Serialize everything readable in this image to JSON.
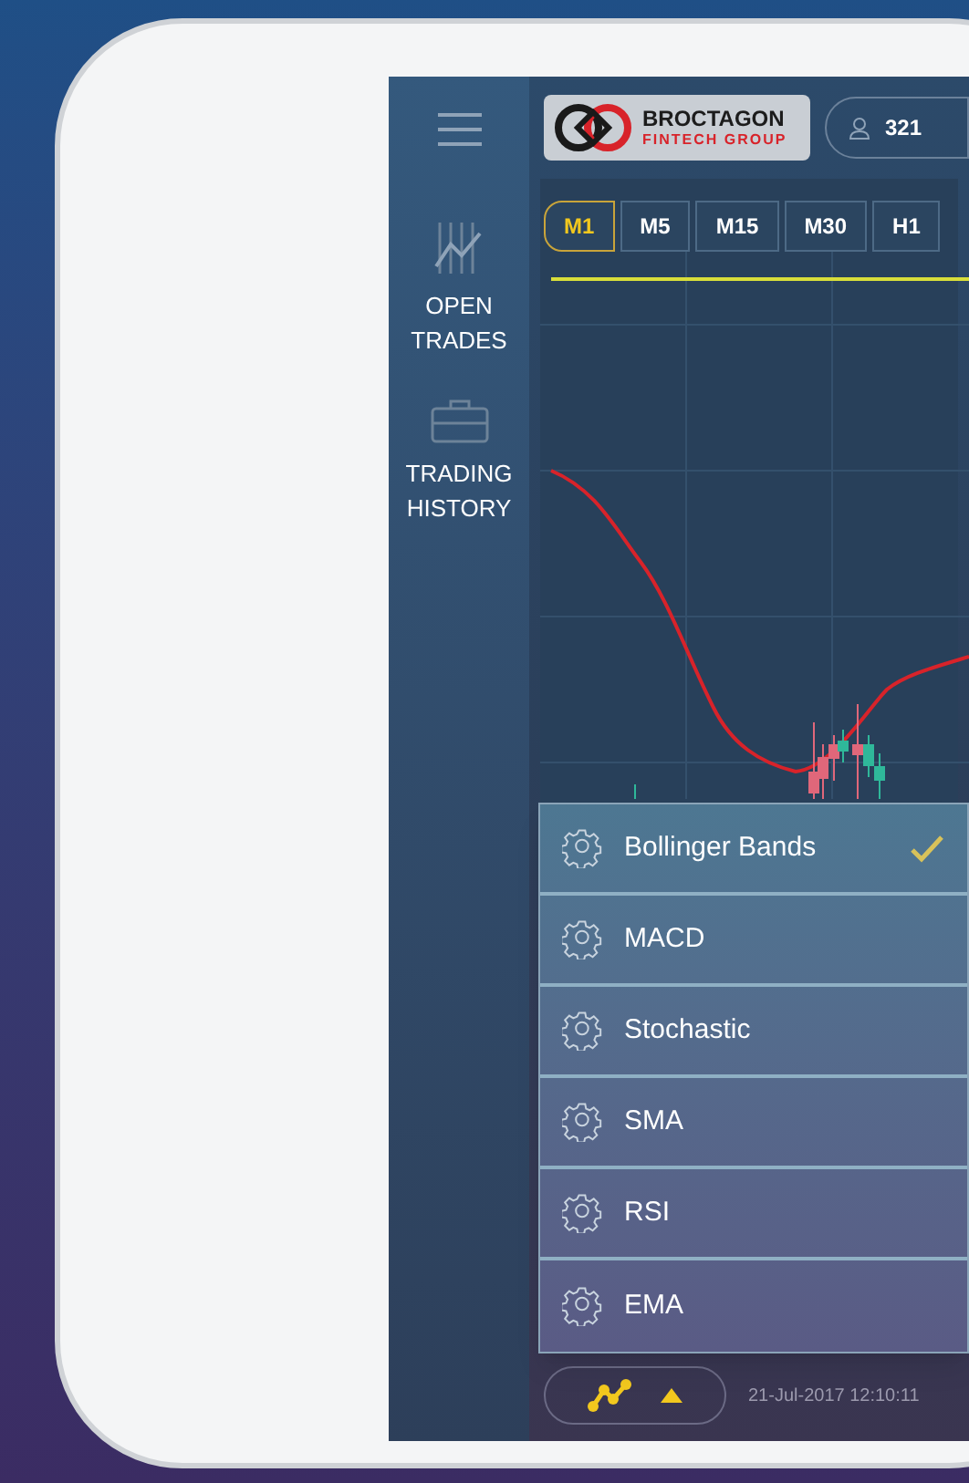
{
  "header": {
    "logo": {
      "name": "BROCTAGON",
      "subtitle": "FINTECH GROUP"
    },
    "account": "321"
  },
  "sidebar": {
    "items": [
      {
        "kind": "trades",
        "label": "OPEN TRADES"
      },
      {
        "kind": "history",
        "label": "TRADING HISTORY"
      }
    ]
  },
  "timeframes": [
    {
      "label": "M1",
      "selected": true
    },
    {
      "label": "M5",
      "selected": false
    },
    {
      "label": "M15",
      "selected": false
    },
    {
      "label": "M30",
      "selected": false
    },
    {
      "label": "H1",
      "selected": false
    }
  ],
  "indicator_menu": [
    {
      "label": "Bollinger Bands",
      "checked": true
    },
    {
      "label": "MACD",
      "checked": false
    },
    {
      "label": "Stochastic",
      "checked": false
    },
    {
      "label": "SMA",
      "checked": false
    },
    {
      "label": "RSI",
      "checked": false
    },
    {
      "label": "EMA",
      "checked": false
    }
  ],
  "bottom_bar": {
    "menu_open": true,
    "timestamp": "21-Jul-2017 12:10:11"
  }
}
